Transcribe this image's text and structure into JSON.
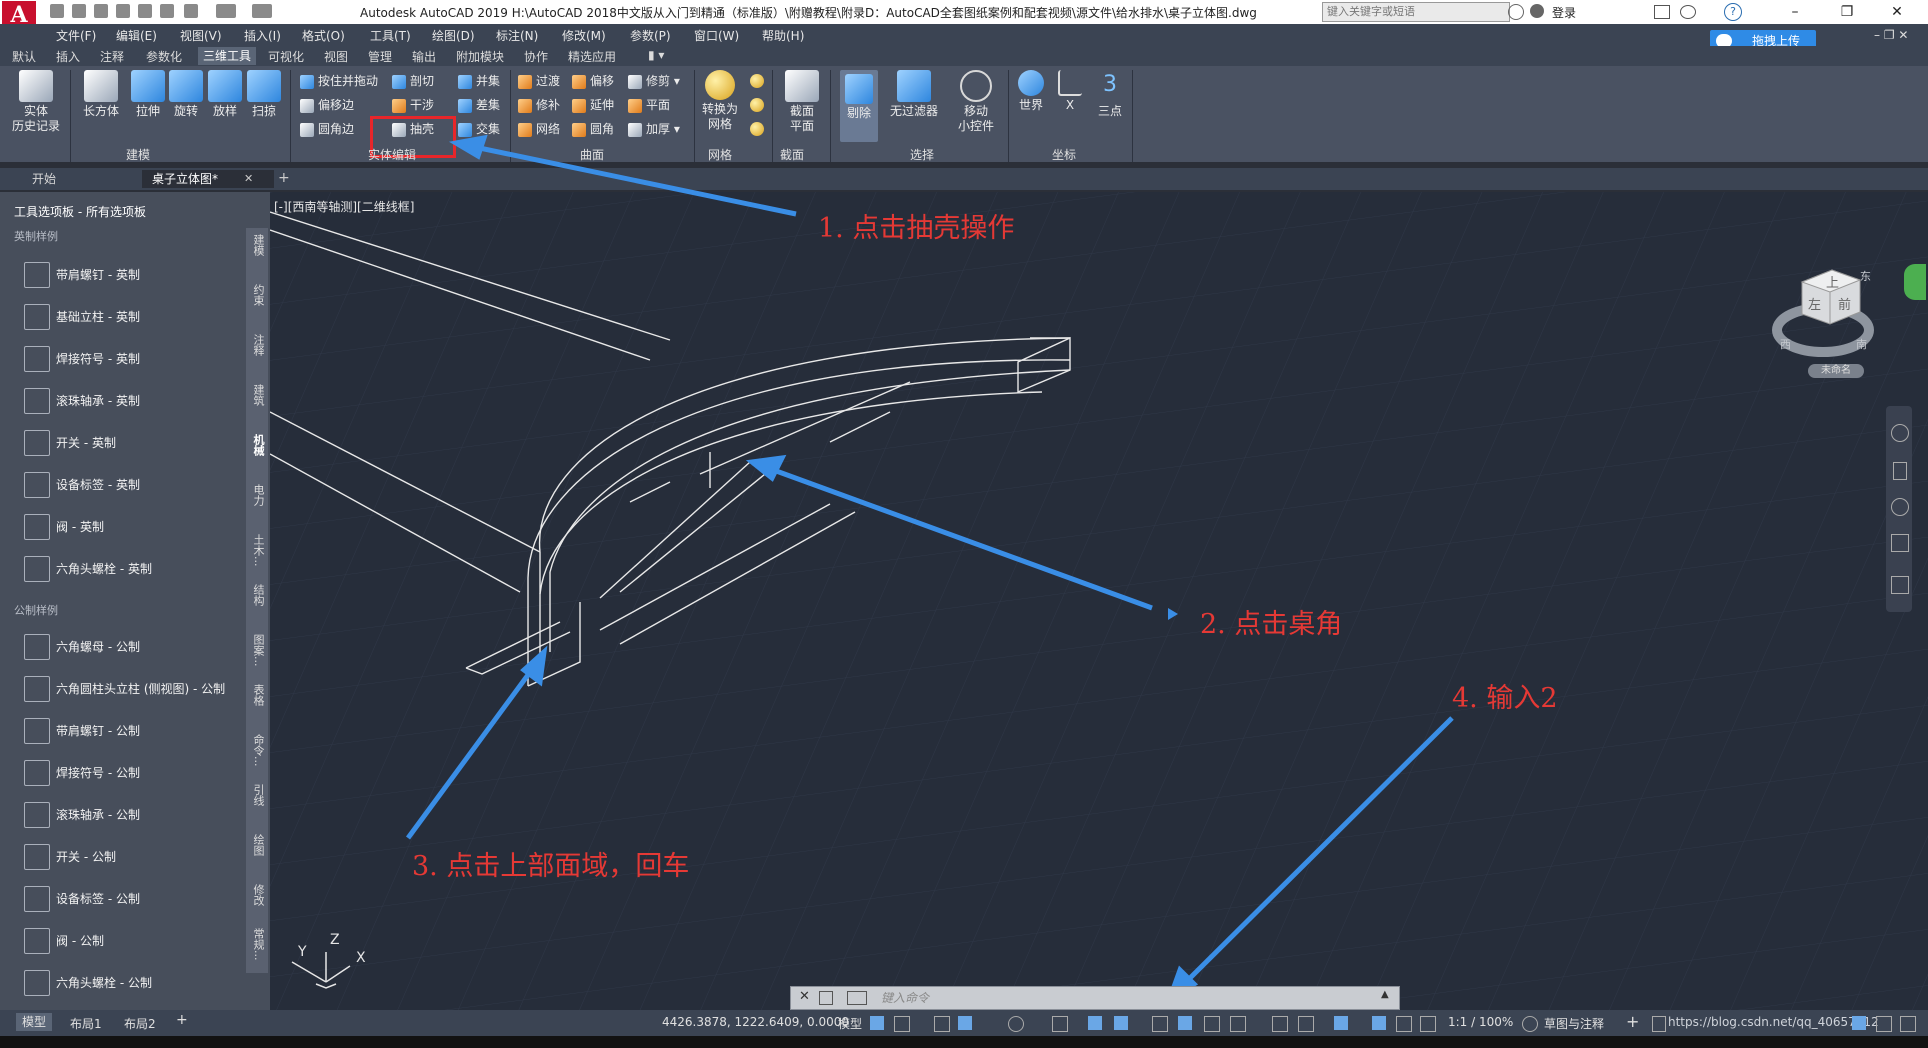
{
  "title_bar": {
    "app_icon": "A",
    "title": "Autodesk AutoCAD 2019    H:\\AutoCAD 2018中文版从入门到精通（标准版）\\附赠教程\\附录D：AutoCAD全套图纸案例和配套视频\\源文件\\给水排水\\桌子立体图.dwg",
    "search_placeholder": "键入关键字或短语",
    "login": "登录",
    "help": "?"
  },
  "menu": [
    "文件(F)",
    "编辑(E)",
    "视图(V)",
    "插入(I)",
    "格式(O)",
    "工具(T)",
    "绘图(D)",
    "标注(N)",
    "修改(M)",
    "参数(P)",
    "窗口(W)",
    "帮助(H)"
  ],
  "upload_button": "拖拽上传",
  "ribbon_tabs": [
    "默认",
    "插入",
    "注释",
    "参数化",
    "三维工具",
    "可视化",
    "视图",
    "管理",
    "输出",
    "附加模块",
    "协作",
    "精选应用"
  ],
  "ribbon_active_tab": "三维工具",
  "ribbon": {
    "modeling": {
      "history": [
        "实体",
        "历史记录"
      ],
      "box": "长方体",
      "extrude": "拉伸",
      "revolve": "旋转",
      "loft": "放样",
      "sweep": "扫掠",
      "label": "建模"
    },
    "solid_edit": {
      "items": [
        "按住并拖动",
        "偏移边",
        "圆角边",
        "剖切",
        "干涉",
        "抽壳",
        "并集",
        "差集",
        "交集"
      ],
      "label": "实体编辑"
    },
    "surface": {
      "items": [
        "过渡",
        "偏移",
        "修剪",
        "修补",
        "延伸",
        "平面",
        "网络",
        "圆角",
        "加厚"
      ],
      "label": "曲面"
    },
    "mesh": {
      "convert": [
        "转换为",
        "网格"
      ],
      "label": "网格"
    },
    "section": {
      "plane": [
        "截面",
        "平面"
      ],
      "label": "截面"
    },
    "selection": {
      "cull": "剔除",
      "nofilter": "无过滤器",
      "gizmo": [
        "移动",
        "小控件"
      ],
      "label": "选择"
    },
    "coordinates": {
      "world": "世界",
      "x": "X",
      "three": "三点",
      "label": "坐标"
    }
  },
  "doc_tabs": [
    "开始",
    "桌子立体图*"
  ],
  "palette": {
    "header": "工具选项板 - 所有选项板",
    "section_imperial": "英制样例",
    "imperial_items": [
      "带肩螺钉 - 英制",
      "基础立柱 - 英制",
      "焊接符号 - 英制",
      "滚珠轴承 - 英制",
      "开关 - 英制",
      "设备标签 - 英制",
      "阀 - 英制",
      "六角头螺栓 - 英制"
    ],
    "section_metric": "公制样例",
    "metric_items": [
      "六角螺母 - 公制",
      "六角圆柱头立柱 (侧视图) - 公制",
      "带肩螺钉 - 公制",
      "焊接符号 - 公制",
      "滚珠轴承 - 公制",
      "开关 - 公制",
      "设备标签 - 公制",
      "阀 - 公制",
      "六角头螺栓 - 公制"
    ],
    "vertical_tabs": [
      "建模",
      "约束",
      "注释",
      "建筑",
      "机械",
      "电力",
      "土木...",
      "结构",
      "图案...",
      "表格",
      "命令...",
      "引线",
      "绘图",
      "修改",
      "常规..."
    ]
  },
  "viewport": {
    "label": "[-][西南等轴测][二维线框]",
    "viewcube": {
      "top": "上",
      "left": "左",
      "front": "前",
      "west": "西",
      "south": "南",
      "east": "东",
      "ucs": "未命名"
    },
    "ucs": {
      "x": "X",
      "y": "Y",
      "z": "Z"
    }
  },
  "annotations": [
    "1. 点击抽壳操作",
    "2. 点击桌角",
    "3. 点击上部面域，回车",
    "4. 输入2"
  ],
  "command_line": {
    "placeholder": "键入命令"
  },
  "layout_tabs": [
    "模型",
    "布局1",
    "布局2"
  ],
  "status_bar": {
    "coords": "4426.3878, 1222.6409, 0.0000",
    "mode": "模型",
    "scale": "1:1 / 100%",
    "workspace": "草图与注释",
    "watermark": "https://blog.csdn.net/qq_40657712"
  },
  "colors": {
    "annotation_red": "#e53935",
    "arrow_blue": "#3a8ee6",
    "viewport_bg": "#262d3a"
  }
}
